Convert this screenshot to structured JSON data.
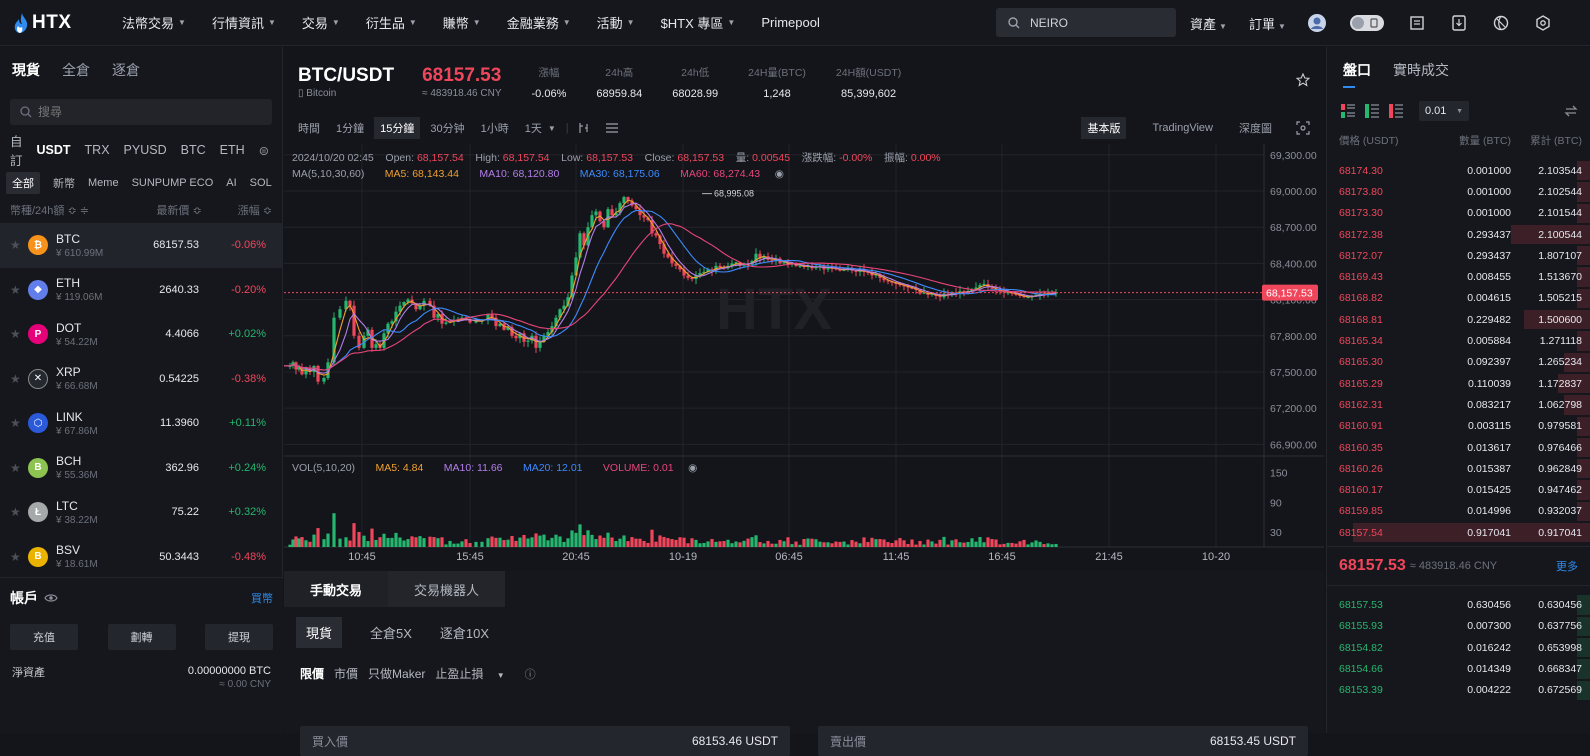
{
  "brand": "HTX",
  "nav": [
    "法幣交易",
    "行情資訊",
    "交易",
    "衍生品",
    "賺幣",
    "金融業務",
    "活動",
    "$HTX 專區",
    "Primepool"
  ],
  "nav_caret": [
    true,
    true,
    true,
    true,
    true,
    true,
    true,
    true,
    false
  ],
  "search": {
    "value": "NEIRO"
  },
  "right_nav": [
    "資產",
    "訂單"
  ],
  "left": {
    "tabs": [
      "現貨",
      "全倉",
      "逐倉"
    ],
    "search_placeholder": "搜尋",
    "quote_tabs": [
      "自訂",
      "USDT",
      "TRX",
      "PYUSD",
      "BTC",
      "ETH"
    ],
    "cat_tabs": [
      "全部",
      "新幣",
      "Meme",
      "SUNPUMP ECO",
      "AI",
      "SOL"
    ],
    "header": {
      "c1": "幣種/24h額 ≎ ≑",
      "c2": "最新價 ≎",
      "c3": "漲幅 ≎"
    },
    "coins": [
      {
        "sym": "BTC",
        "vol": "¥ 610.99M",
        "price": "68157.53",
        "chg": "-0.06%",
        "color": "#f7931a",
        "glyph": "₿"
      },
      {
        "sym": "ETH",
        "vol": "¥ 119.06M",
        "price": "2640.33",
        "chg": "-0.20%",
        "color": "#627eea",
        "glyph": "◆"
      },
      {
        "sym": "DOT",
        "vol": "¥ 54.22M",
        "price": "4.4066",
        "chg": "+0.02%",
        "color": "#e6007a",
        "glyph": "P"
      },
      {
        "sym": "XRP",
        "vol": "¥ 66.68M",
        "price": "0.54225",
        "chg": "-0.38%",
        "color": "#23292f",
        "glyph": "✕"
      },
      {
        "sym": "LINK",
        "vol": "¥ 67.86M",
        "price": "11.3960",
        "chg": "+0.11%",
        "color": "#2a5ada",
        "glyph": "⬡"
      },
      {
        "sym": "BCH",
        "vol": "¥ 55.36M",
        "price": "362.96",
        "chg": "+0.24%",
        "color": "#8dc351",
        "glyph": "B"
      },
      {
        "sym": "LTC",
        "vol": "¥ 38.22M",
        "price": "75.22",
        "chg": "+0.32%",
        "color": "#a6a9aa",
        "glyph": "Ł"
      },
      {
        "sym": "BSV",
        "vol": "¥ 18.61M",
        "price": "50.3443",
        "chg": "-0.48%",
        "color": "#eab300",
        "glyph": "B"
      }
    ],
    "account": {
      "title": "帳戶",
      "buy": "買幣",
      "buttons": [
        "充值",
        "劃轉",
        "提現"
      ],
      "asset_label": "淨資產",
      "asset_btc": "0.00000000 BTC",
      "asset_cny": "≈ 0.00 CNY"
    }
  },
  "ticker": {
    "pair": "BTC/USDT",
    "name": "Bitcoin",
    "last": "68157.53",
    "cny": "≈ 483918.46 CNY",
    "stats": [
      {
        "label": "漲幅",
        "value": "-0.06%",
        "red": true
      },
      {
        "label": "24h高",
        "value": "68959.84"
      },
      {
        "label": "24h低",
        "value": "68028.99"
      },
      {
        "label": "24H量(BTC)",
        "value": "1,248"
      },
      {
        "label": "24H額(USDT)",
        "value": "85,399,602"
      }
    ]
  },
  "chart_tools": {
    "timeframes": [
      "時間",
      "1分鐘",
      "15分鐘",
      "30分钟",
      "1小時",
      "1天"
    ],
    "active": "15分鐘",
    "views": [
      "基本版",
      "TradingView",
      "深度圖"
    ]
  },
  "ohlc": {
    "time": "2024/10/20 02:45",
    "open_l": "Open:",
    "open": "68,157.54",
    "high_l": "High:",
    "high": "68,157.54",
    "low_l": "Low:",
    "low": "68,157.53",
    "close_l": "Close:",
    "close": "68,157.53",
    "vol_l": "量:",
    "vol": "0.00545",
    "chg_l": "漲跌幅:",
    "chg": "-0.00%",
    "amp_l": "振幅:",
    "amp": "0.00%"
  },
  "ma": {
    "label": "MA(5,10,30,60)",
    "ma5": "MA5: 68,143.44",
    "ma10": "MA10: 68,120.80",
    "ma30": "MA30: 68,175.06",
    "ma60": "MA60: 68,274.43"
  },
  "volma": {
    "label": "VOL(5,10,20)",
    "ma5": "MA5: 4.84",
    "ma10": "MA10: 11.66",
    "ma20": "MA20: 12.01",
    "vol": "VOLUME: 0.01"
  },
  "chart_data": {
    "type": "candlestick",
    "price_axis": [
      "69,300.00",
      "69,000.00",
      "68,700.00",
      "68,400.00",
      "68,100.00",
      "67,800.00",
      "67,500.00",
      "67,200.00",
      "66,900.00"
    ],
    "price_ticks": [
      69300,
      69000,
      68700,
      68400,
      68100,
      67800,
      67500,
      67200,
      66900
    ],
    "ylim": [
      66820,
      69390
    ],
    "vol_axis": [
      "150",
      "90",
      "30"
    ],
    "vol_ticks": [
      150,
      90,
      30
    ],
    "vol_ylim": [
      0,
      175
    ],
    "time_axis": [
      "10:45",
      "15:45",
      "20:45",
      "10-19",
      "06:45",
      "11:45",
      "16:45",
      "21:45",
      "10-20"
    ],
    "last_price_label": "68,157.53",
    "last_price": 68157.53,
    "high_marker": "68,995.08",
    "high_value": 68995.08,
    "price_anchor_t": [
      0,
      6,
      9,
      12,
      15,
      18,
      22,
      26,
      30,
      34,
      40,
      44,
      50,
      56,
      62,
      66,
      70,
      75,
      80,
      84,
      88,
      92,
      96,
      100,
      104,
      108,
      112,
      116,
      120,
      124,
      128,
      132,
      136,
      140,
      146,
      150,
      154,
      158,
      162,
      166,
      170,
      174,
      178,
      182,
      186,
      192,
      198,
      204,
      208,
      212,
      216,
      220,
      224,
      228,
      232,
      236,
      240,
      244,
      248,
      252,
      256,
      260,
      264,
      268,
      272,
      276,
      280,
      284,
      288,
      292,
      296,
      300,
      304,
      308,
      312,
      316,
      320,
      324,
      328,
      332,
      336,
      340,
      344,
      348,
      352,
      356,
      360,
      364,
      368,
      372,
      376,
      380,
      384,
      388,
      392,
      396,
      400,
      404,
      408,
      412,
      416,
      420,
      424,
      428,
      432,
      436,
      440,
      444,
      448,
      452,
      456,
      460,
      464,
      468,
      472,
      476,
      480,
      484,
      488,
      492,
      496,
      500,
      504,
      508,
      512,
      516,
      520,
      524,
      528,
      532,
      536,
      540,
      544,
      548,
      552,
      556,
      560,
      564,
      568,
      572,
      576,
      580,
      584,
      588,
      592,
      596,
      600,
      604,
      608,
      612,
      616,
      620,
      624,
      628,
      632,
      636,
      640,
      644,
      648,
      652,
      656,
      660,
      664,
      668,
      672,
      676,
      680,
      684,
      688,
      692,
      696,
      700,
      704,
      708,
      712,
      716,
      720,
      724,
      728,
      732,
      736,
      740,
      744,
      748,
      752,
      756,
      760,
      764,
      768,
      772,
      776,
      780,
      784,
      788,
      792,
      796,
      800,
      804,
      808,
      812,
      816,
      820,
      824,
      828,
      832,
      836,
      840,
      844,
      848,
      852,
      856,
      860,
      864,
      868,
      872,
      876,
      880,
      884,
      888,
      892,
      896,
      900,
      904,
      908,
      912,
      916,
      920,
      924,
      928,
      932,
      936
    ],
    "price_anchor_v": [
      67550,
      67550,
      67580,
      67520,
      67540,
      67480,
      67530,
      67500,
      67550,
      67420,
      67450,
      67580,
      67950,
      68020,
      68090,
      68050,
      67800,
      67700,
      67800,
      67850,
      67700,
      67730,
      67700,
      67820,
      67900,
      67920,
      68000,
      68050,
      68080,
      68100,
      68070,
      68020,
      68050,
      68090,
      68050,
      67950,
      67980,
      67900,
      67910,
      67920,
      67930,
      67930,
      67950,
      67940,
      67910,
      67920,
      67930,
      67980,
      67950,
      67880,
      67900,
      67850,
      67870,
      67800,
      67780,
      67820,
      67750,
      67760,
      67800,
      67700,
      67750,
      67800,
      67830,
      67880,
      67950,
      68020,
      68050,
      68120,
      68300,
      68450,
      68650,
      68550,
      68700,
      68800,
      68830,
      68750,
      68700,
      68850,
      68800,
      68820,
      68900,
      68950,
      68920,
      68880,
      68850,
      68800,
      68780,
      68760,
      68650,
      68630,
      68560,
      68480,
      68450,
      68400,
      68380,
      68350,
      68300,
      68280,
      68270,
      68300,
      68320,
      68330,
      68350,
      68340,
      68380,
      68370,
      68360,
      68380,
      68400,
      68410,
      68380,
      68400,
      68390,
      68420,
      68480,
      68440,
      68460,
      68430,
      68420,
      68440,
      68400,
      68410,
      68390,
      68400,
      68380,
      68380,
      68370,
      68380,
      68360,
      68370,
      68380,
      68350,
      68370,
      68360,
      68350,
      68340,
      68350,
      68360,
      68340,
      68330,
      68350,
      68330,
      68320,
      68300,
      68310,
      68280,
      68260,
      68250,
      68240,
      68230,
      68220,
      68210,
      68200,
      68190,
      68180,
      68150,
      68160,
      68140,
      68150,
      68130,
      68120,
      68150,
      68140,
      68160,
      68150,
      68170,
      68160,
      68170,
      68180,
      68200,
      68220,
      68230,
      68200,
      68190,
      68180,
      68170,
      68160,
      68160,
      68150,
      68140,
      68130,
      68120,
      68120,
      68130,
      68140,
      68150,
      68145,
      68150,
      68155,
      68157
    ]
  },
  "trade": {
    "tabs": [
      "手動交易",
      "交易機器人"
    ],
    "mode_tabs": [
      "現貨",
      "全倉5X",
      "逐倉10X"
    ],
    "order_tabs": [
      "限價",
      "市價",
      "只做Maker",
      "止盈止損"
    ],
    "buy_label": "買入價",
    "buy_val": "68153.46  USDT",
    "sell_label": "賣出價",
    "sell_val": "68153.45  USDT"
  },
  "orderbook": {
    "tabs": [
      "盤口",
      "實時成交"
    ],
    "precision": "0.01",
    "header": [
      "價格 (USDT)",
      "數量 (BTC)",
      "累計 (BTC)"
    ],
    "asks": [
      [
        "68174.30",
        "0.001000",
        "2.103544",
        0.05
      ],
      [
        "68173.80",
        "0.001000",
        "2.102544",
        0.05
      ],
      [
        "68173.30",
        "0.001000",
        "2.101544",
        0.05
      ],
      [
        "68172.38",
        "0.293437",
        "2.100544",
        0.3
      ],
      [
        "68172.07",
        "0.293437",
        "1.807107",
        0.05
      ],
      [
        "68169.43",
        "0.008455",
        "1.513670",
        0.05
      ],
      [
        "68168.82",
        "0.004615",
        "1.505215",
        0.05
      ],
      [
        "68168.81",
        "0.229482",
        "1.500600",
        0.25
      ],
      [
        "68165.34",
        "0.005884",
        "1.271118",
        0.05
      ],
      [
        "68165.30",
        "0.092397",
        "1.265234",
        0.1
      ],
      [
        "68165.29",
        "0.110039",
        "1.172837",
        0.12
      ],
      [
        "68162.31",
        "0.083217",
        "1.062798",
        0.1
      ],
      [
        "68160.91",
        "0.003115",
        "0.979581",
        0.05
      ],
      [
        "68160.35",
        "0.013617",
        "0.976466",
        0.05
      ],
      [
        "68160.26",
        "0.015387",
        "0.962849",
        0.05
      ],
      [
        "68160.17",
        "0.015425",
        "0.947462",
        0.05
      ],
      [
        "68159.85",
        "0.014996",
        "0.932037",
        0.05
      ],
      [
        "68157.54",
        "0.917041",
        "0.917041",
        0.9
      ]
    ],
    "mid_price": "68157.53",
    "mid_cny": "≈ 483918.46 CNY",
    "more": "更多",
    "bids": [
      [
        "68157.53",
        "0.630456",
        "0.630456",
        0.05
      ],
      [
        "68155.93",
        "0.007300",
        "0.637756",
        0.05
      ],
      [
        "68154.82",
        "0.016242",
        "0.653998",
        0.05
      ],
      [
        "68154.66",
        "0.014349",
        "0.668347",
        0.05
      ],
      [
        "68153.39",
        "0.004222",
        "0.672569",
        0.05
      ]
    ]
  }
}
